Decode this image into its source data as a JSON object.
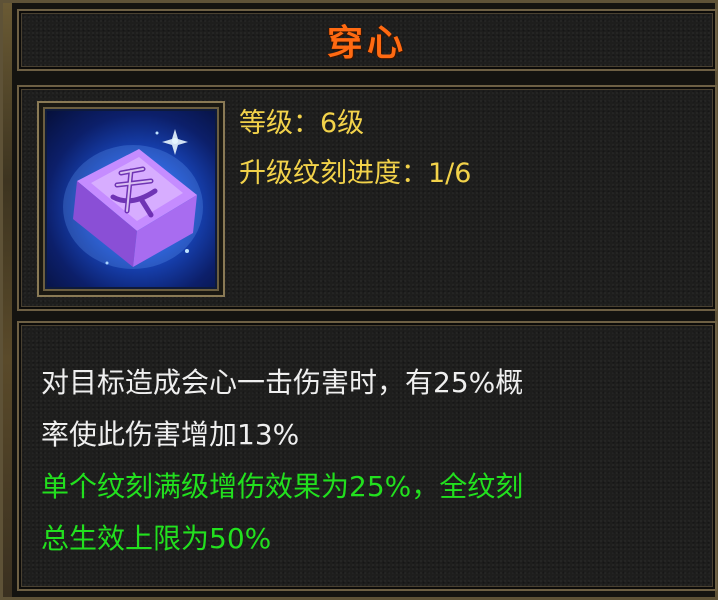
{
  "title": "穿心",
  "icon": {
    "name": "rune-crystal-icon",
    "glyph": ""
  },
  "stats": {
    "level": "等级：6级",
    "progress": "升级纹刻进度：1/6"
  },
  "description": {
    "lines": [
      "对目标造成会心一击伤害时，有25%概",
      "率使此伤害增加13%"
    ],
    "bonus_lines": [
      "单个纹刻满级增伤效果为25%，全纹刻",
      "总生效上限为50%"
    ]
  },
  "colors": {
    "title": "#ff6a12",
    "stat_text": "#f2d24a",
    "description_text": "#efefef",
    "bonus_text": "#22e01e",
    "frame": "#6e6044"
  }
}
